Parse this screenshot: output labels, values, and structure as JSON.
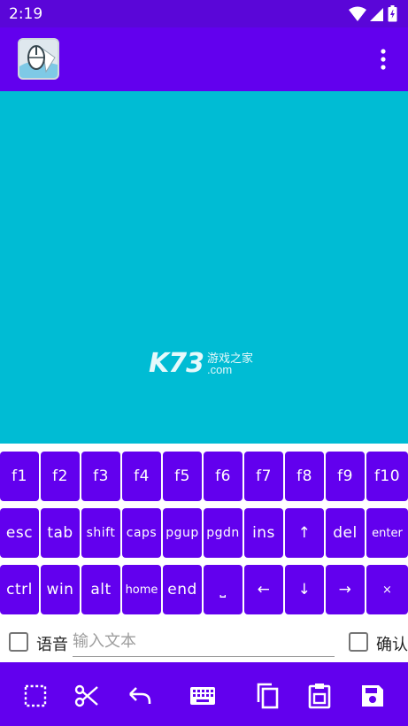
{
  "status": {
    "time": "2:19"
  },
  "keys": {
    "row1": [
      "f1",
      "f2",
      "f3",
      "f4",
      "f5",
      "f6",
      "f7",
      "f8",
      "f9",
      "f10"
    ],
    "row2": [
      "esc",
      "tab",
      "shift",
      "caps",
      "pgup",
      "pgdn",
      "ins",
      "↑",
      "del",
      "enter"
    ],
    "row3": [
      "ctrl",
      "win",
      "alt",
      "home",
      "end",
      "⎵",
      "←",
      "↓",
      "→",
      "×"
    ]
  },
  "input": {
    "voice_label": "语音",
    "placeholder": "输入文本",
    "confirm_label": "确认"
  },
  "colors": {
    "primary": "#6200ee",
    "status": "#5a06d8",
    "touchpad": "#00bcd4"
  }
}
